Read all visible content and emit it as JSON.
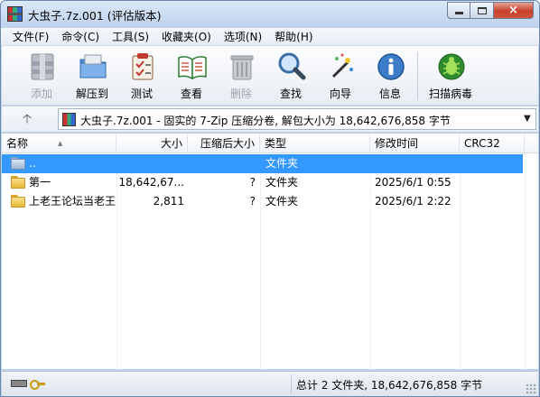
{
  "window": {
    "title": "大虫子.7z.001 (评估版本)",
    "controls": {
      "minimize": "minimize-icon",
      "maximize": "maximize-icon",
      "close": "×"
    }
  },
  "menu": {
    "items": [
      "文件(F)",
      "命令(C)",
      "工具(S)",
      "收藏夹(O)",
      "选项(N)",
      "帮助(H)"
    ]
  },
  "toolbar": {
    "buttons": [
      {
        "label": "添加",
        "icon": "archive-add-icon",
        "enabled": false
      },
      {
        "label": "解压到",
        "icon": "extract-folder-icon",
        "enabled": true
      },
      {
        "label": "测试",
        "icon": "test-clipboard-icon",
        "enabled": true
      },
      {
        "label": "查看",
        "icon": "book-view-icon",
        "enabled": true
      },
      {
        "label": "删除",
        "icon": "trash-delete-icon",
        "enabled": false
      },
      {
        "label": "查找",
        "icon": "magnifier-find-icon",
        "enabled": true
      },
      {
        "label": "向导",
        "icon": "wizard-wand-icon",
        "enabled": true
      },
      {
        "label": "信息",
        "icon": "info-icon",
        "enabled": true
      },
      {
        "label": "扫描病毒",
        "icon": "virus-scan-icon",
        "enabled": true
      }
    ]
  },
  "address": {
    "up_icon": "up-arrow-icon",
    "text": "大虫子.7z.001 - 固实的 7-Zip 压缩分卷, 解包大小为 18,642,676,858 字节",
    "dropdown_glyph": "▼"
  },
  "list": {
    "columns": [
      "名称",
      "大小",
      "压缩后大小",
      "类型",
      "修改时间",
      "CRC32"
    ],
    "rows": [
      {
        "name": "..",
        "size": "",
        "packed": "",
        "type": "文件夹",
        "modified": "",
        "crc": "",
        "icon": "parent-folder-icon",
        "selected": true
      },
      {
        "name": "第一",
        "size": "18,642,67...",
        "packed": "?",
        "type": "文件夹",
        "modified": "2025/6/1 0:55",
        "crc": "",
        "icon": "folder-icon",
        "selected": false
      },
      {
        "name": "上老王论坛当老王",
        "size": "2,811",
        "packed": "?",
        "type": "文件夹",
        "modified": "2025/6/1 2:22",
        "crc": "",
        "icon": "folder-icon",
        "selected": false
      }
    ]
  },
  "status": {
    "left_icons": [
      "drive-icon",
      "key-icon"
    ],
    "text": "总计 2 文件夹, 18,642,676,858 字节"
  },
  "colors": {
    "selection": "#3399ff",
    "window_frame": "#bcd3ee",
    "close_button": "#c7402b"
  }
}
